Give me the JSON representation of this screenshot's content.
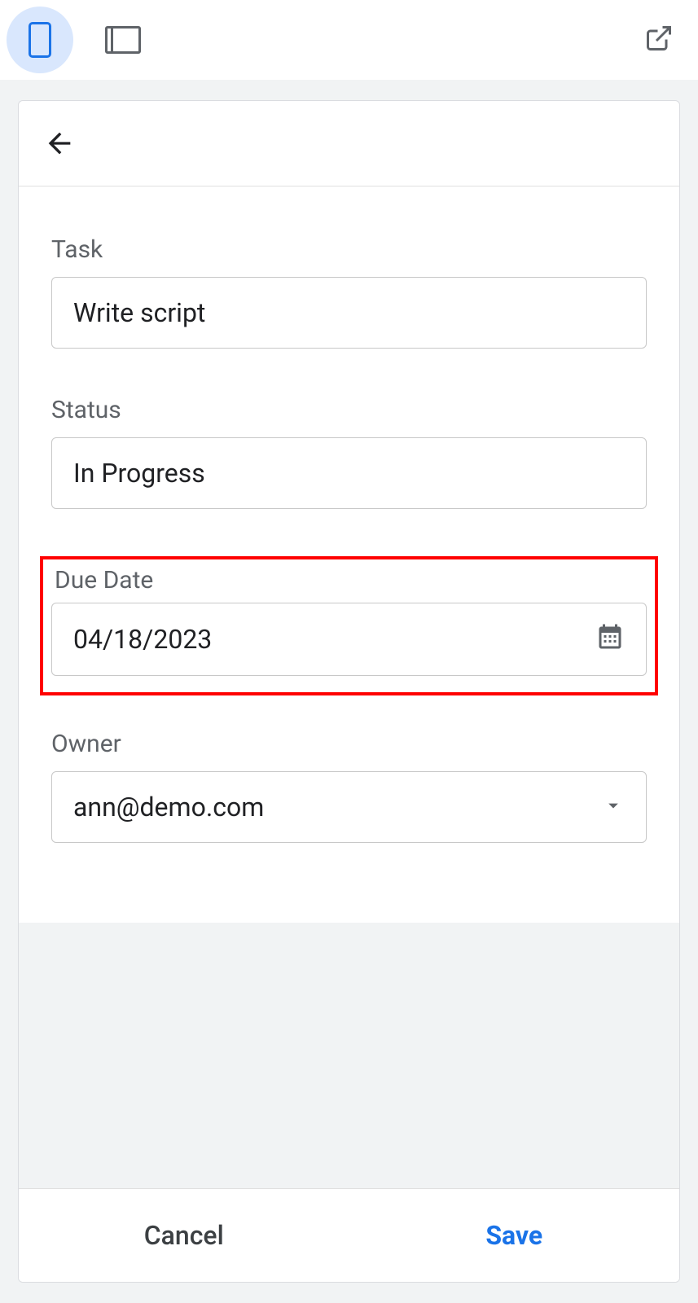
{
  "toolbar": {
    "phone_view_active": true
  },
  "form": {
    "task": {
      "label": "Task",
      "value": "Write script"
    },
    "status": {
      "label": "Status",
      "value": "In Progress"
    },
    "due_date": {
      "label": "Due Date",
      "value": "04/18/2023"
    },
    "owner": {
      "label": "Owner",
      "value": "ann@demo.com"
    }
  },
  "footer": {
    "cancel_label": "Cancel",
    "save_label": "Save"
  }
}
